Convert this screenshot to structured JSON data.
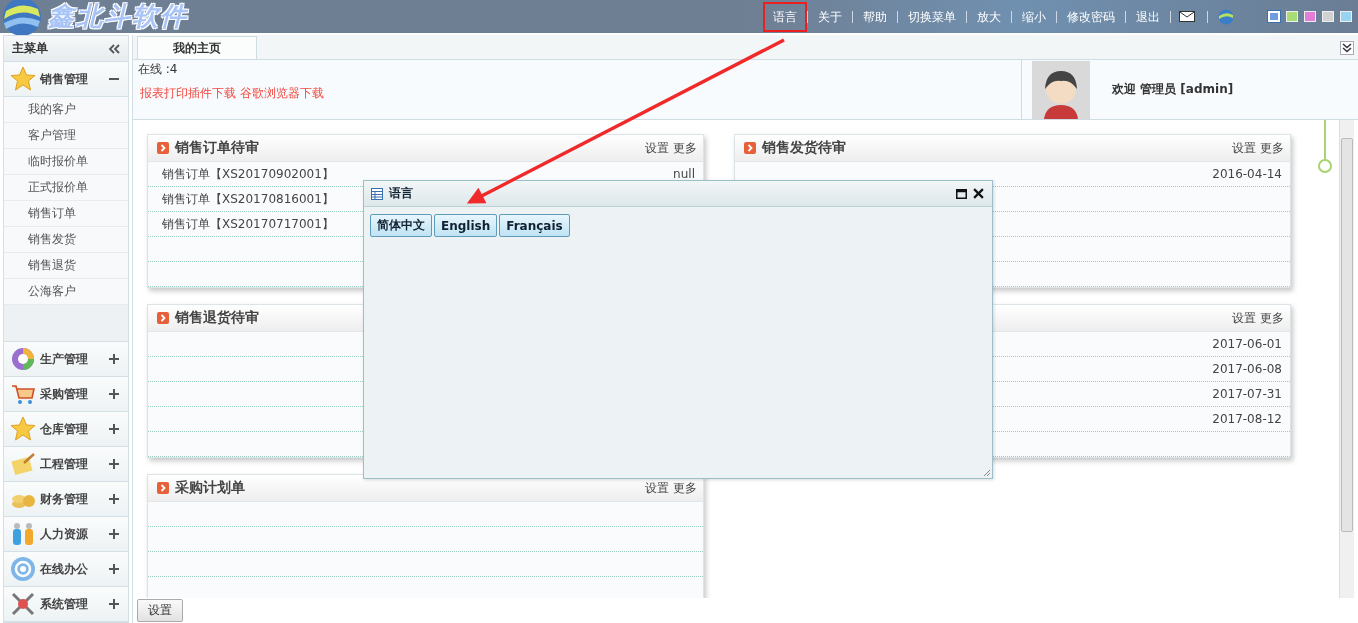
{
  "header": {
    "logo_text": "鑫北斗软件",
    "nav": [
      {
        "label": "语言",
        "highlighted": true
      },
      {
        "label": "关于",
        "highlighted": false
      },
      {
        "label": "帮助",
        "highlighted": false
      },
      {
        "label": "切换菜单",
        "highlighted": false
      },
      {
        "label": "放大",
        "highlighted": false
      },
      {
        "label": "缩小",
        "highlighted": false
      },
      {
        "label": "修改密码",
        "highlighted": false
      },
      {
        "label": "退出",
        "highlighted": false
      }
    ],
    "skins": [
      {
        "color": "#6f9be0",
        "selected": true
      },
      {
        "color": "#a8dc74",
        "selected": false
      },
      {
        "color": "#e27ed8",
        "selected": false
      },
      {
        "color": "#d2d2d2",
        "selected": false
      },
      {
        "color": "#96d4f2",
        "selected": false
      }
    ]
  },
  "sidebar": {
    "title": "主菜单",
    "groups": [
      {
        "label": "销售管理",
        "expanded": true,
        "children": [
          {
            "label": "我的客户"
          },
          {
            "label": "客户管理"
          },
          {
            "label": "临时报价单"
          },
          {
            "label": "正式报价单"
          },
          {
            "label": "销售订单"
          },
          {
            "label": "销售发货"
          },
          {
            "label": "销售退货"
          },
          {
            "label": "公海客户"
          }
        ]
      },
      {
        "label": "生产管理",
        "expanded": false
      },
      {
        "label": "采购管理",
        "expanded": false
      },
      {
        "label": "仓库管理",
        "expanded": false
      },
      {
        "label": "工程管理",
        "expanded": false
      },
      {
        "label": "财务管理",
        "expanded": false
      },
      {
        "label": "人力资源",
        "expanded": false
      },
      {
        "label": "在线办公",
        "expanded": false
      },
      {
        "label": "系统管理",
        "expanded": false
      }
    ]
  },
  "tabs": [
    {
      "label": "我的主页",
      "selected": true
    }
  ],
  "info": {
    "online": "在线 :4",
    "links": [
      "报表打印插件下载",
      "谷歌浏览器下载"
    ],
    "welcome": "欢迎 管理员 [admin]"
  },
  "portal_columns": [
    [
      {
        "title": "销售订单待审",
        "actions": [
          "设置",
          "更多"
        ],
        "rows": [
          {
            "text": "销售订单【XS20170902001】",
            "date": "null"
          },
          {
            "text": "销售订单【XS20170816001】"
          },
          {
            "text": "销售订单【XS20170717001】"
          }
        ]
      },
      {
        "title": "销售退货待审"
      },
      {
        "title": "采购计划单",
        "actions": [
          "设置",
          "更多"
        ]
      }
    ],
    [
      {
        "title": "销售发货待审",
        "actions": [
          "设置",
          "更多"
        ],
        "rows": [
          {
            "date": "2016-04-14"
          }
        ]
      },
      {
        "actions": [
          "设置",
          "更多"
        ],
        "rows": [
          {
            "date": "2017-06-01"
          },
          {
            "date": "2017-06-08"
          },
          {
            "date": "2017-07-31"
          },
          {
            "date": "2017-08-12"
          }
        ]
      }
    ]
  ],
  "footer": {
    "button": "设置"
  },
  "dialog": {
    "title": "语言",
    "buttons": [
      "简体中文",
      "English",
      "Français"
    ]
  }
}
